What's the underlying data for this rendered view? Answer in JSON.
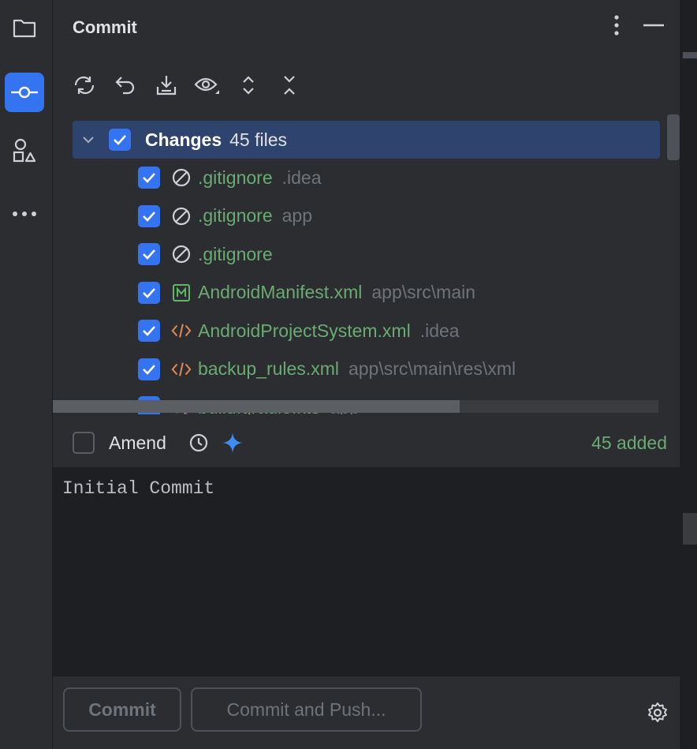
{
  "panel": {
    "title": "Commit"
  },
  "strip": {
    "items": [
      {
        "icon": "folder-icon"
      },
      {
        "icon": "commit-icon",
        "active": true
      },
      {
        "icon": "structure-icon"
      },
      {
        "icon": "more-icon"
      }
    ]
  },
  "toolbar": {
    "items": [
      "refresh-icon",
      "rollback-icon",
      "shelve-icon",
      "preview-icon",
      "expand-all-icon",
      "collapse-all-icon"
    ]
  },
  "tree": {
    "root": {
      "label": "Changes",
      "count": "45 files"
    },
    "files": [
      {
        "name": ".gitignore",
        "path": ".idea",
        "icon": "ignored-file-icon"
      },
      {
        "name": ".gitignore",
        "path": "app",
        "icon": "ignored-file-icon"
      },
      {
        "name": ".gitignore",
        "path": "",
        "icon": "ignored-file-icon"
      },
      {
        "name": "AndroidManifest.xml",
        "path": "app\\src\\main",
        "icon": "manifest-icon"
      },
      {
        "name": "AndroidProjectSystem.xml",
        "path": ".idea",
        "icon": "xml-icon"
      },
      {
        "name": "backup_rules.xml",
        "path": "app\\src\\main\\res\\xml",
        "icon": "xml-icon"
      },
      {
        "name": "build.gradle.kts",
        "path": "app",
        "icon": "gradle-icon"
      }
    ]
  },
  "amend": {
    "label": "Amend",
    "summary": "45 added"
  },
  "message": {
    "value": "Initial Commit"
  },
  "actions": {
    "commit_label": "Commit",
    "commit_push_label": "Commit and Push..."
  },
  "colors": {
    "accent": "#3574f0",
    "added": "#6aab73",
    "path": "#6f737a",
    "selection": "#2e436e"
  }
}
